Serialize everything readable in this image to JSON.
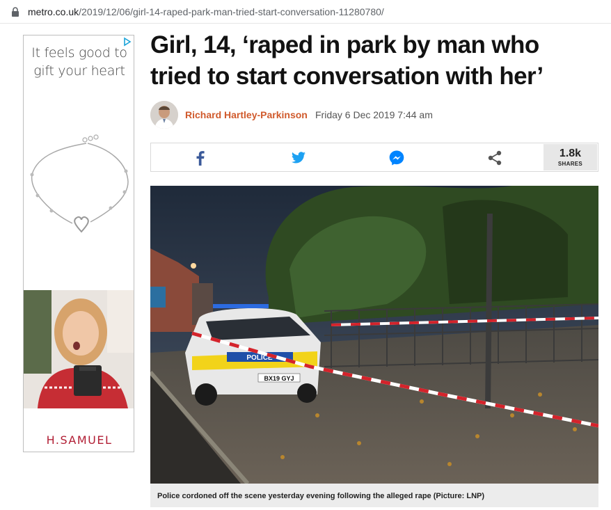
{
  "browser": {
    "url_host": "metro.co.uk",
    "url_path": "/2019/12/06/girl-14-raped-park-man-tried-start-conversation-11280780/"
  },
  "ad": {
    "tagline_line1": "It feels good to",
    "tagline_line2": "gift your heart",
    "brand": "H.SAMUEL",
    "brand_color": "#b11e34"
  },
  "article": {
    "headline_line1": "Girl, 14, ‘raped in park by man who",
    "headline_line2": "tried to start conversation with her’",
    "author": "Richard Hartley-Parkinson",
    "author_color": "#d05a2c",
    "date": "Friday 6 Dec 2019 7:44 am",
    "image_caption": "Police cordoned off the scene yesterday evening following the alleged rape (Picture: LNP)",
    "image_plate": "BX19 GYJ",
    "image_police_text": "POLICE"
  },
  "share": {
    "facebook_icon": "facebook-icon",
    "twitter_icon": "twitter-icon",
    "messenger_icon": "messenger-icon",
    "share_icon": "share-icon",
    "count": "1.8k",
    "count_label": "SHARES"
  }
}
